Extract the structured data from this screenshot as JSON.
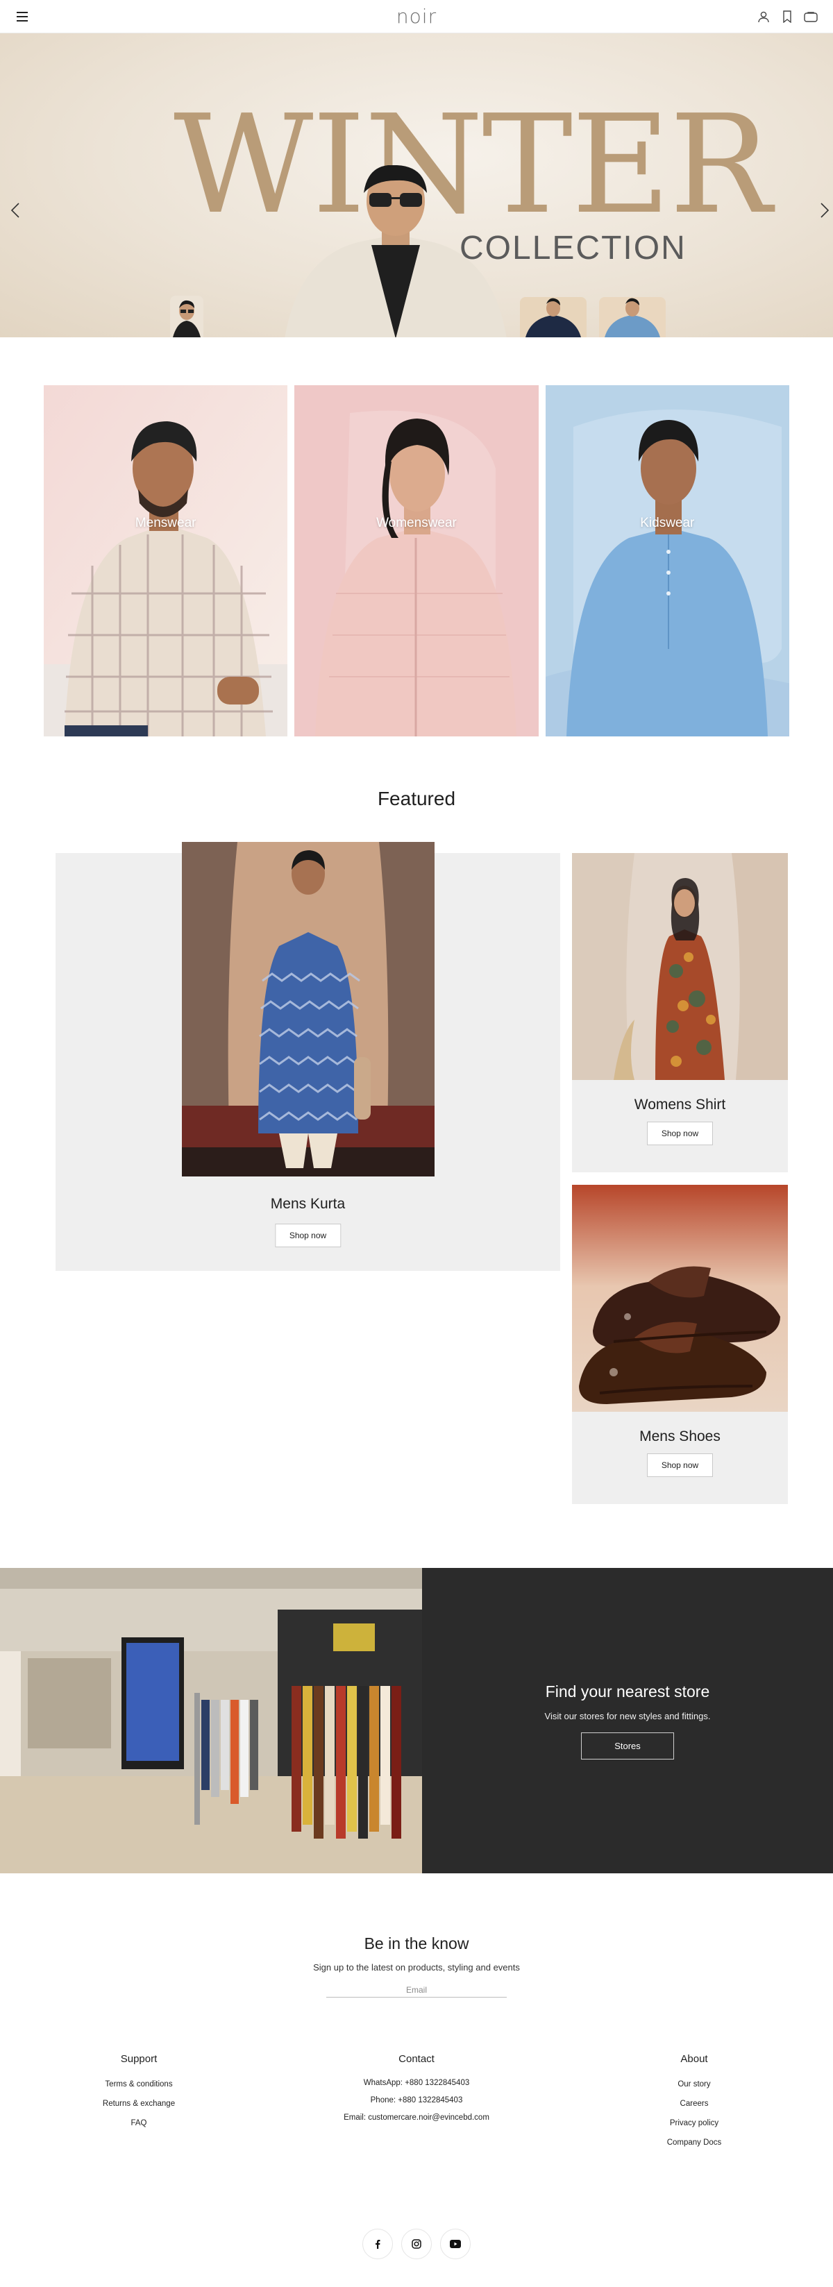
{
  "header": {
    "brand": "noir",
    "icons": [
      "menu-icon",
      "user-icon",
      "bookmark-icon",
      "cart-icon"
    ]
  },
  "hero": {
    "headline": "WINTER",
    "subheadline": "COLLECTION"
  },
  "categories": [
    {
      "label": "Menswear"
    },
    {
      "label": "Womenswear"
    },
    {
      "label": "Kidswear"
    }
  ],
  "featured": {
    "title": "Featured",
    "items": [
      {
        "title": "Mens Kurta",
        "button": "Shop now"
      },
      {
        "title": "Womens Shirt",
        "button": "Shop now"
      },
      {
        "title": "Mens Shoes",
        "button": "Shop now"
      }
    ]
  },
  "store": {
    "title": "Find your nearest store",
    "subtitle": "Visit our stores for new styles and fittings.",
    "button": "Stores"
  },
  "newsletter": {
    "title": "Be in the know",
    "subtitle": "Sign up to the latest on products, styling and events",
    "email_placeholder": "Email"
  },
  "footer": {
    "support": {
      "title": "Support",
      "links": [
        "Terms & conditions",
        "Returns & exchange",
        "FAQ"
      ]
    },
    "contact": {
      "title": "Contact",
      "lines": [
        "WhatsApp: +880 1322845403",
        "Phone: +880 1322845403",
        "Email: customercare.noir@evincebd.com"
      ]
    },
    "about": {
      "title": "About",
      "links": [
        "Our story",
        "Careers",
        "Privacy policy",
        "Company Docs"
      ]
    },
    "socials": [
      "facebook-icon",
      "instagram-icon",
      "youtube-icon"
    ]
  }
}
